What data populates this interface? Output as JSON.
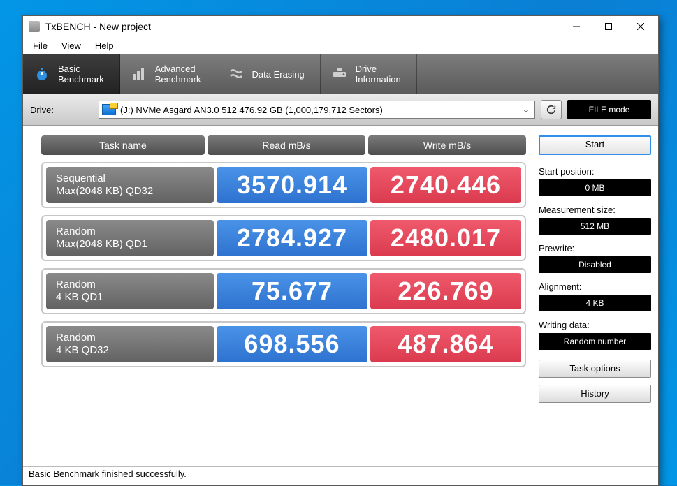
{
  "window": {
    "title": "TxBENCH - New project"
  },
  "menu": {
    "file": "File",
    "view": "View",
    "help": "Help"
  },
  "tabs": {
    "basic": {
      "line1": "Basic",
      "line2": "Benchmark"
    },
    "advanced": {
      "line1": "Advanced",
      "line2": "Benchmark"
    },
    "erase": {
      "line1": "Data Erasing"
    },
    "drive": {
      "line1": "Drive",
      "line2": "Information"
    }
  },
  "drive": {
    "label": "Drive:",
    "selected": "(J:) NVMe Asgard AN3.0 512  476.92 GB (1,000,179,712 Sectors)",
    "filemode": "FILE mode"
  },
  "headers": {
    "name": "Task name",
    "read": "Read mB/s",
    "write": "Write mB/s"
  },
  "rows": [
    {
      "name1": "Sequential",
      "name2": "Max(2048 KB) QD32",
      "read": "3570.914",
      "write": "2740.446"
    },
    {
      "name1": "Random",
      "name2": "Max(2048 KB) QD1",
      "read": "2784.927",
      "write": "2480.017"
    },
    {
      "name1": "Random",
      "name2": "4 KB QD1",
      "read": "75.677",
      "write": "226.769"
    },
    {
      "name1": "Random",
      "name2": "4 KB QD32",
      "read": "698.556",
      "write": "487.864"
    }
  ],
  "side": {
    "start": "Start",
    "pos_lbl": "Start position:",
    "pos_val": "0 MB",
    "size_lbl": "Measurement size:",
    "size_val": "512 MB",
    "pre_lbl": "Prewrite:",
    "pre_val": "Disabled",
    "align_lbl": "Alignment:",
    "align_val": "4 KB",
    "wr_lbl": "Writing data:",
    "wr_val": "Random number",
    "opts": "Task options",
    "hist": "History"
  },
  "status": "Basic Benchmark finished successfully."
}
